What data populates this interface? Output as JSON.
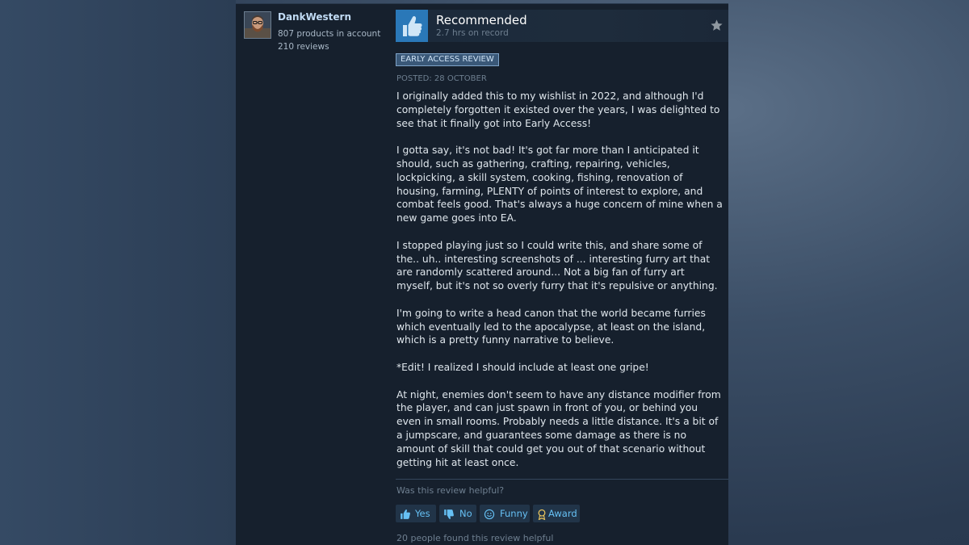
{
  "author": {
    "name": "DankWestern",
    "products": "807 products in account",
    "reviews": "210 reviews"
  },
  "review": {
    "verdict": "Recommended",
    "hours": "2.7 hrs on record",
    "badge": "EARLY ACCESS REVIEW",
    "posted": "POSTED: 28 OCTOBER",
    "paragraphs": [
      "I originally added this to my wishlist in 2022, and although I'd completely forgotten it existed over the years, I was delighted to see that it finally got into Early Access!",
      "I gotta say, it's not bad! It's got far more than I anticipated it should, such as gathering, crafting, repairing, vehicles, lockpicking, a skill system, cooking, fishing, renovation of housing, farming, PLENTY of points of interest to explore, and combat feels good. That's always a huge concern of mine when a new game goes into EA.",
      "I stopped playing just so I could write this, and share some of the.. uh.. interesting screenshots of ... interesting furry art that are randomly scattered around... Not a big fan of furry art myself, but it's not so overly furry that it's repulsive or anything.",
      "I'm going to write a head canon that the world became furries which eventually led to the apocalypse, at least on the island, which is a pretty funny narrative to believe.",
      "*Edit! I realized I should include at least one gripe!",
      "At night, enemies don't seem to have any distance modifier from the player, and can just spawn in front of you, or behind you even in small rooms. Probably needs a little distance. It's a bit of a jumpscare, and guarantees some damage as there is no amount of skill that could get you out of that scenario without getting hit at least once."
    ]
  },
  "footer": {
    "question": "Was this review helpful?",
    "buttons": {
      "yes": "Yes",
      "no": "No",
      "funny": "Funny",
      "award": "Award"
    },
    "helpful_count": "20 people found this review helpful"
  },
  "icons": {
    "thumb": "thumbs-up-icon",
    "star": "star-icon",
    "yes": "thumbs-up-icon",
    "no": "thumbs-down-icon",
    "funny": "smiley-icon",
    "award": "award-ribbon-icon"
  },
  "colors": {
    "accent_link": "#66c0f4",
    "thumb_bg": "#2a78b8",
    "panel_bg": "#16202d"
  }
}
